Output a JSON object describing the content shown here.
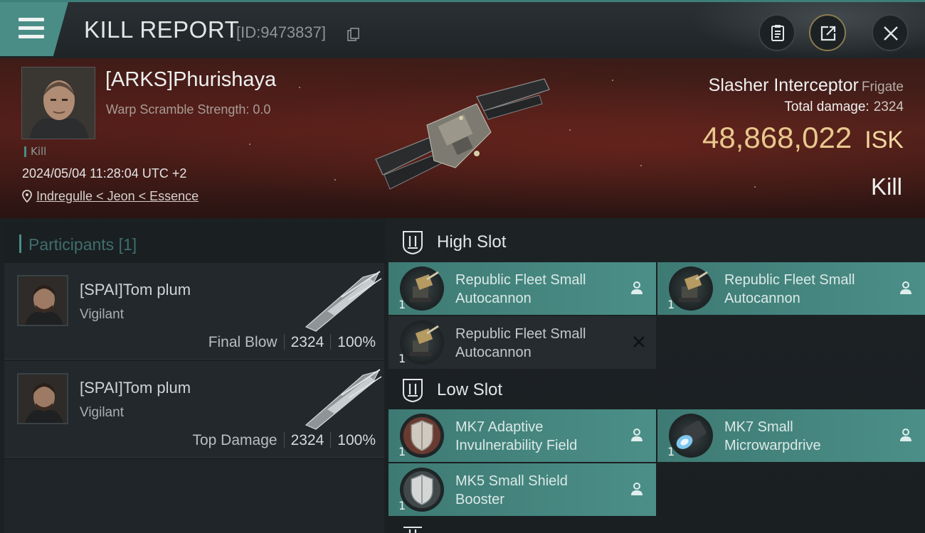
{
  "header": {
    "title": "KILL REPORT",
    "report_id": "[ID:9473837]",
    "icons": [
      "menu-icon",
      "copy-icon",
      "clipboard-icon",
      "share-icon",
      "close-icon"
    ],
    "accent_color": "#4a8d87"
  },
  "victim": {
    "name": "[ARKS]Phurishaya",
    "scramble": "Warp Scramble Strength: 0.0",
    "tag": "Kill",
    "timestamp": "2024/05/04 11:28:04 UTC +2",
    "location": "Indregulle < Jeon < Essence",
    "ship_name": "Slasher Interceptor",
    "ship_class": "Frigate",
    "total_damage_label": "Total damage:",
    "total_damage": "2324",
    "isk_value": "48,868,022",
    "isk_unit": "ISK",
    "result": "Kill",
    "isk_color": "#e8c88e"
  },
  "participants": {
    "title": "Participants",
    "count": "[1]",
    "rows": [
      {
        "name": "[SPAI]Tom plum",
        "ship": "Vigilant",
        "role": "Final Blow",
        "damage": "2324",
        "percent": "100%"
      },
      {
        "name": "[SPAI]Tom plum",
        "ship": "Vigilant",
        "role": "Top Damage",
        "damage": "2324",
        "percent": "100%"
      }
    ]
  },
  "fitting": {
    "high_slot_label": "High Slot",
    "low_slot_label": "Low Slot",
    "high_modules": [
      {
        "name_line1": "Republic Fleet Small",
        "name_line2": "Autocannon",
        "qty": "1",
        "state": "dropped"
      },
      {
        "name_line1": "Republic Fleet Small",
        "name_line2": "Autocannon",
        "qty": "1",
        "state": "dropped"
      },
      {
        "name_line1": "Republic Fleet Small",
        "name_line2": "Autocannon",
        "qty": "1",
        "state": "destroyed"
      }
    ],
    "low_modules": [
      {
        "name_line1": "MK7 Adaptive",
        "name_line2": "Invulnerability Field",
        "qty": "1",
        "state": "dropped"
      },
      {
        "name_line1": "MK7 Small",
        "name_line2": "Microwarpdrive",
        "qty": "1",
        "state": "dropped"
      },
      {
        "name_line1": "MK5 Small Shield",
        "name_line2": "Booster",
        "qty": "1",
        "state": "dropped"
      }
    ]
  }
}
